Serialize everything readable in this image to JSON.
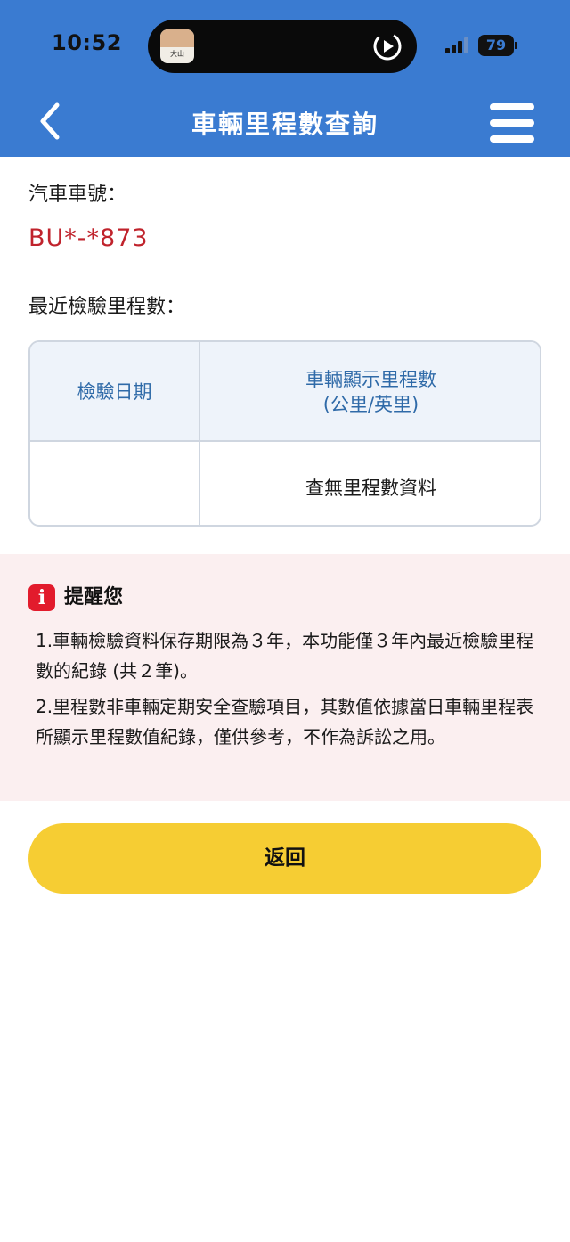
{
  "status_bar": {
    "time": "10:52",
    "battery": "79",
    "island_thumb_text": "大山"
  },
  "header": {
    "title": "車輛里程數查詢",
    "back_icon": "chevron-left-icon",
    "menu_icon": "hamburger-menu-icon",
    "color": "#3a7bd1"
  },
  "vehicle": {
    "plate_label": "汽車車號：",
    "plate_number": "BU*-*873",
    "plate_color": "#c0232c"
  },
  "mileage": {
    "section_label": "最近檢驗里程數：",
    "columns": [
      "檢驗日期",
      "車輛顯示里程數",
      "(公里/英里)"
    ],
    "rows": [
      {
        "date": "",
        "value": "查無里程數資料"
      }
    ]
  },
  "notice": {
    "title": "提醒您",
    "items": [
      "1.車輛檢驗資料保存期限為３年，本功能僅３年內最近檢驗里程數的紀錄 (共２筆)。",
      "2.里程數非車輛定期安全查驗項目，其數值依據當日車輛里程表所顯示里程數值紀錄，僅供參考，不作為訴訟之用。"
    ]
  },
  "actions": {
    "return_label": "返回",
    "return_color": "#f6cd33"
  }
}
